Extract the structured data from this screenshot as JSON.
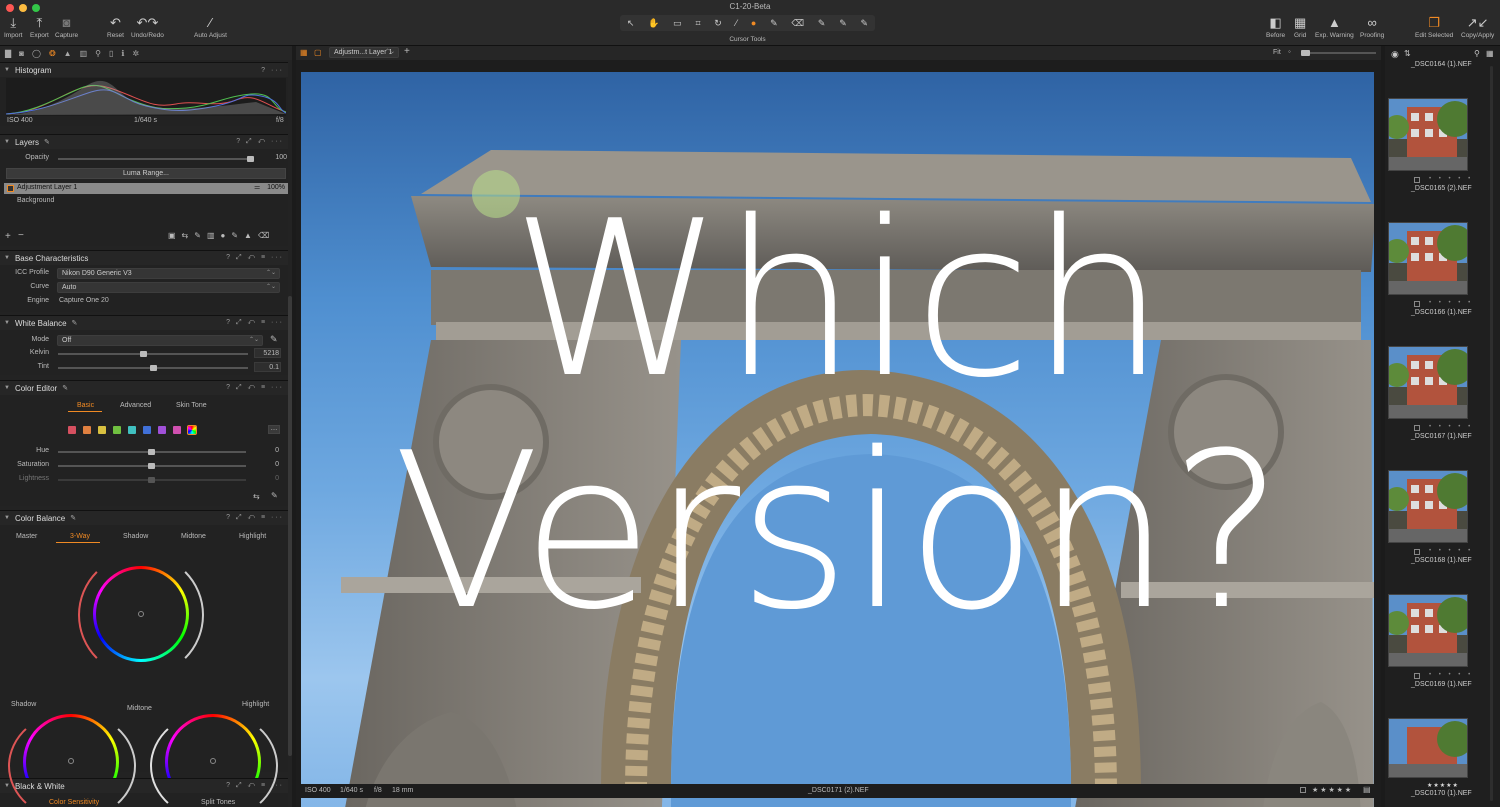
{
  "window": {
    "title": "C1-20-Beta",
    "traffic": [
      "#fc5753",
      "#fdbc40",
      "#33c748"
    ]
  },
  "toolbar_left": [
    {
      "icon": "download-icon",
      "label": "Import"
    },
    {
      "icon": "upload-icon",
      "label": "Export"
    },
    {
      "icon": "camera-icon",
      "label": "Capture"
    },
    {
      "icon": "undo-icon",
      "label": "Reset"
    },
    {
      "icon": "undo-redo-icon",
      "label": "Undo/Redo"
    },
    {
      "icon": "wand-icon",
      "label": "Auto Adjust"
    }
  ],
  "cursor_tools": {
    "label": "Cursor Tools",
    "icons": [
      "↖",
      "✋",
      "▭",
      "⌗",
      "↻",
      "⁄",
      "●",
      "✎",
      "⌫",
      "✎",
      "✎",
      "✎"
    ]
  },
  "toolbar_right": [
    {
      "icon": "before-icon",
      "label": "Before"
    },
    {
      "icon": "grid-icon",
      "label": "Grid"
    },
    {
      "icon": "warning-icon",
      "label": "Exp. Warning"
    },
    {
      "icon": "glasses-icon",
      "label": "Proofing"
    },
    {
      "icon": "edit-selected-icon",
      "label": "Edit Selected"
    },
    {
      "icon": "copy-apply-icon",
      "label": "Copy/Apply"
    }
  ],
  "histogram": {
    "title": "Histogram",
    "iso": "ISO 400",
    "shutter": "1/640 s",
    "aperture": "f/8"
  },
  "layers": {
    "title": "Layers",
    "opacity_label": "Opacity",
    "opacity_value": "100",
    "luma_button": "Luma Range...",
    "items": [
      {
        "name": "Adjustment Layer 1",
        "value": "100%"
      },
      {
        "name": "Background"
      }
    ]
  },
  "base": {
    "title": "Base Characteristics",
    "icc_label": "ICC Profile",
    "icc_value": "Nikon D90 Generic V3",
    "curve_label": "Curve",
    "curve_value": "Auto",
    "engine_label": "Engine",
    "engine_value": "Capture One 20"
  },
  "wb": {
    "title": "White Balance",
    "mode_label": "Mode",
    "mode_value": "Off",
    "kelvin_label": "Kelvin",
    "kelvin_value": "5218",
    "kelvin_pos": 0.45,
    "tint_label": "Tint",
    "tint_value": "0.1",
    "tint_pos": 0.5
  },
  "color_editor": {
    "title": "Color Editor",
    "tabs": [
      "Basic",
      "Advanced",
      "Skin Tone"
    ],
    "swatches": [
      "#d65060",
      "#e08040",
      "#d8c040",
      "#70c040",
      "#40c0c0",
      "#4070d8",
      "#a050d8",
      "#d050b0",
      "#ccc"
    ],
    "hue_label": "Hue",
    "hue_value": "0",
    "sat_label": "Saturation",
    "sat_value": "0",
    "light_label": "Lightness",
    "light_value": "0"
  },
  "color_balance": {
    "title": "Color Balance",
    "tabs": [
      "Master",
      "3-Way",
      "Shadow",
      "Midtone",
      "Highlight"
    ],
    "labels": [
      "Shadow",
      "Midtone",
      "Highlight"
    ]
  },
  "bw": {
    "title": "Black & White",
    "tabs": [
      "Color Sensitivity",
      "Split Tones"
    ]
  },
  "viewer": {
    "layer_dropdown": "Adjustm...t Layer 1",
    "fit": "Fit",
    "overlay_line1": "Which",
    "overlay_line2": "Version?",
    "iso": "ISO 400",
    "shutter": "1/640 s",
    "aperture": "f/8",
    "focal": "18 mm",
    "filename": "_DSC0171 (2).NEF",
    "rating": "★ ★ ★ ★ ★"
  },
  "filmstrip": {
    "top_name": "_DSC0164 (1).NEF",
    "items": [
      {
        "name": "_DSC0165 (2).NEF"
      },
      {
        "name": "_DSC0166 (1).NEF"
      },
      {
        "name": "_DSC0167 (1).NEF"
      },
      {
        "name": "_DSC0168 (1).NEF"
      },
      {
        "name": "_DSC0169 (1).NEF"
      }
    ],
    "last_rating": "★★★★★",
    "last_name": "_DSC0170 (1).NEF"
  }
}
